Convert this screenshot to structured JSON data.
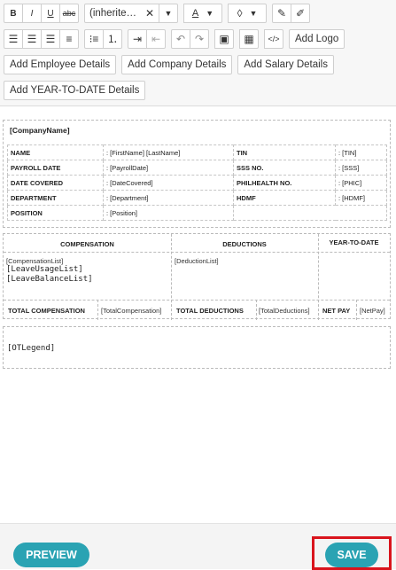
{
  "toolbar": {
    "font_family": "(inherite…",
    "actions": {
      "add_logo": "Add Logo",
      "add_employee_details": "Add Employee Details",
      "add_company_details": "Add Company Details",
      "add_salary_details": "Add Salary Details",
      "add_ytd_details": "Add YEAR-TO-DATE Details"
    },
    "format": {
      "bold": "B",
      "italic": "I",
      "underline": "U",
      "strike": "abc"
    },
    "icons": [
      "bold-icon",
      "italic-icon",
      "underline-icon",
      "strikethrough-icon",
      "clear-font-icon",
      "font-color-icon",
      "fill-color-icon",
      "brush-icon",
      "eraser-icon",
      "align-left-icon",
      "align-center-icon",
      "align-right-icon",
      "justify-icon",
      "bullet-list-icon",
      "numbered-list-icon",
      "indent-icon",
      "outdent-icon",
      "undo-icon",
      "redo-icon",
      "image-icon",
      "table-icon",
      "code-icon"
    ]
  },
  "doc": {
    "company_name": "[CompanyName]",
    "info_rows": [
      {
        "l1": "NAME",
        "v1": ": [FirstName] [LastName]",
        "l2": "TIN",
        "v2": ": [TIN]"
      },
      {
        "l1": "PAYROLL DATE",
        "v1": ": [PayrollDate]",
        "l2": "SSS NO.",
        "v2": ": [SSS]"
      },
      {
        "l1": "DATE COVERED",
        "v1": ": [DateCovered]",
        "l2": "PHILHEALTH NO.",
        "v2": ": [PHIC]"
      },
      {
        "l1": "DEPARTMENT",
        "v1": ": [Department]",
        "l2": "HDMF",
        "v2": ": [HDMF]"
      },
      {
        "l1": "POSITION",
        "v1": ": [Position]"
      }
    ],
    "compensation_header": "COMPENSATION",
    "deductions_header": "DEDUCTIONS",
    "ytd_header": "YEAR-TO-DATE",
    "compensation_list": "[CompensationList]",
    "leave_usage_list": "[LeaveUsageList]",
    "leave_balance_list": "[LeaveBalanceList]",
    "deduction_list": "[DeductionList]",
    "total_compensation_label": "TOTAL COMPENSATION",
    "total_compensation_value": "[TotalCompensation]",
    "total_deductions_label": "TOTAL DEDUCTIONS",
    "total_deductions_value": "[TotalDeductions]",
    "net_pay_label": "NET PAY",
    "net_pay_value": "[NetPay]",
    "ot_legend": "[OTLegend]"
  },
  "footer": {
    "preview": "PREVIEW",
    "save": "SAVE"
  },
  "colors": {
    "accent": "#2aa3b3",
    "highlight": "#d9141c"
  }
}
